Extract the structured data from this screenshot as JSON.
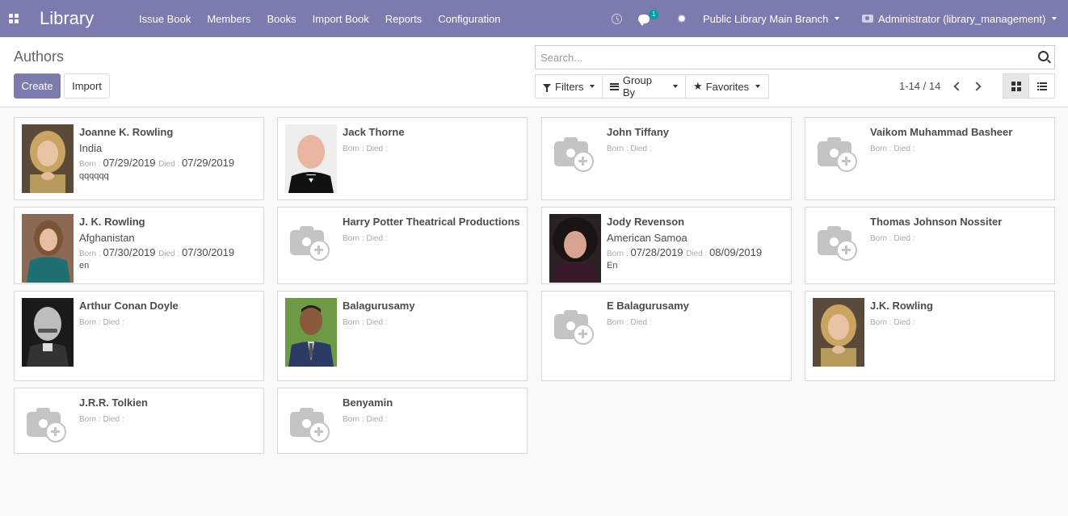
{
  "navbar": {
    "brand": "Library",
    "menu": [
      "Issue Book",
      "Members",
      "Books",
      "Import Book",
      "Reports",
      "Configuration"
    ],
    "chat_badge": "1",
    "branch": "Public Library Main Branch",
    "user": "Administrator (library_management)"
  },
  "control": {
    "title": "Authors",
    "create": "Create",
    "import": "Import",
    "search_placeholder": "Search...",
    "filters": "Filters",
    "group_by": "Group By",
    "favorites": "Favorites",
    "pager": "1-14 / 14"
  },
  "labels": {
    "born": "Born :",
    "died": "Died :"
  },
  "authors": [
    {
      "name": "Joanne K. Rowling",
      "nationality": "India",
      "born": "07/29/2019",
      "died": "07/29/2019",
      "note": "qqqqqq",
      "photo": "blonde-woman"
    },
    {
      "name": "Jack Thorne",
      "nationality": "",
      "born": "",
      "died": "",
      "note": "",
      "photo": "bald-man-tux"
    },
    {
      "name": "John Tiffany",
      "nationality": "",
      "born": "",
      "died": "",
      "note": "",
      "photo": ""
    },
    {
      "name": "Vaikom Muhammad Basheer",
      "nationality": "",
      "born": "",
      "died": "",
      "note": "",
      "photo": ""
    },
    {
      "name": "J. K. Rowling",
      "nationality": "Afghanistan",
      "born": "07/30/2019",
      "died": "07/30/2019",
      "note": "en",
      "photo": "woman-teal"
    },
    {
      "name": "Harry Potter Theatrical Productions",
      "nationality": "",
      "born": "",
      "died": "",
      "note": "",
      "photo": ""
    },
    {
      "name": "Jody Revenson",
      "nationality": "American Samoa",
      "born": "07/28/2019",
      "died": "08/09/2019",
      "note": "En",
      "photo": "curly-woman"
    },
    {
      "name": "Thomas Johnson Nossiter",
      "nationality": "",
      "born": "",
      "died": "",
      "note": "",
      "photo": ""
    },
    {
      "name": "Arthur Conan Doyle",
      "nationality": "",
      "born": "",
      "died": "",
      "note": "",
      "photo": "bw-mustache"
    },
    {
      "name": "Balagurusamy",
      "nationality": "",
      "born": "",
      "died": "",
      "note": "",
      "photo": "man-suit-green"
    },
    {
      "name": "E Balagurusamy",
      "nationality": "",
      "born": "",
      "died": "",
      "note": "",
      "photo": ""
    },
    {
      "name": "J.K. Rowling",
      "nationality": "",
      "born": "",
      "died": "",
      "note": "",
      "photo": "blonde-woman"
    },
    {
      "name": "J.R.R. Tolkien",
      "nationality": "",
      "born": "",
      "died": "",
      "note": "",
      "photo": ""
    },
    {
      "name": "Benyamin",
      "nationality": "",
      "born": "",
      "died": "",
      "note": "",
      "photo": ""
    }
  ]
}
